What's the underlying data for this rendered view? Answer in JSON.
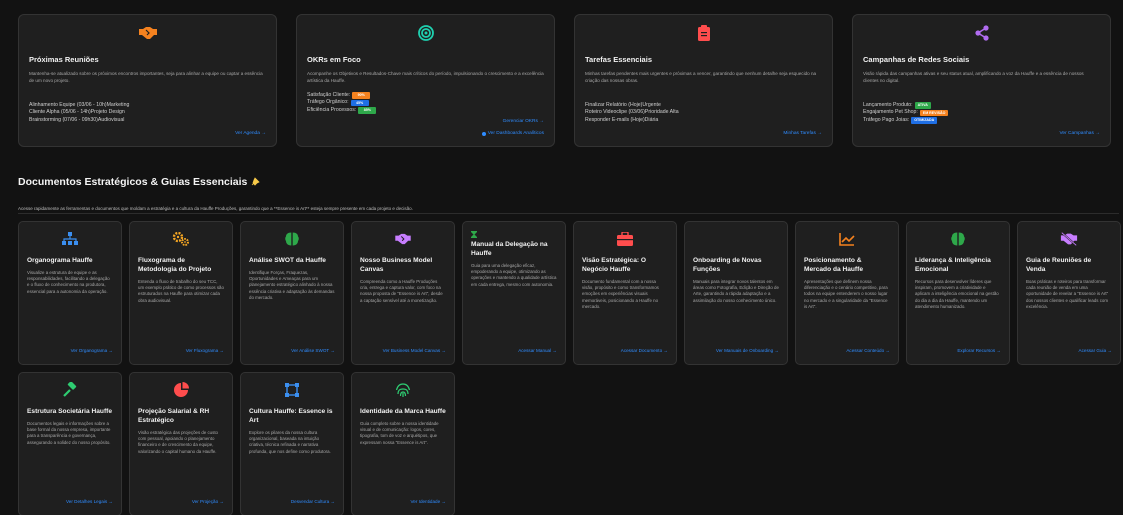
{
  "colors": {
    "accent": "#2f8cff",
    "orange": "#f5821f",
    "green": "#2ea84a",
    "blue": "#1f6fe5",
    "red": "#ff4d4d"
  },
  "top_cards": [
    {
      "icon": "handshake-icon",
      "title": "Próximas Reuniões",
      "desc": "Mantenha-se atualizado sobre os próximos encontros importantes, seja para alinhar a equipe ou captar a essência de um novo projeto.",
      "items": [
        "Alinhamento Equipe (03/06 - 10h)Marketing",
        "Cliente Alpha (05/06 - 14h)Projeto Design",
        "Brainstorming (07/06 - 09h30)Audiovisual"
      ],
      "link": "Ver Agenda →"
    },
    {
      "icon": "target-icon",
      "title": "OKRs em Foco",
      "desc": "Acompanhe os Objetivos e Resultados-Chave mais críticos do período, impulsionando o crescimento e a excelência artística da Hauffe.",
      "items": [
        {
          "label": "Satisfação Cliente:",
          "badge": "90%",
          "color": "#f5821f"
        },
        {
          "label": "Tráfego Orgânico:",
          "badge": "45%",
          "color": "#1f6fe5"
        },
        {
          "label": "Eficiência Processos:",
          "badge": "85%",
          "color": "#2ea84a"
        }
      ],
      "link": "Gerenciar OKRs →",
      "link2": "Ver Dashboards Analíticos"
    },
    {
      "icon": "clipboard-icon",
      "title": "Tarefas Essenciais",
      "desc": "Minhas tarefas pendentes mais urgentes e próximas a vencer, garantindo que nenhum detalhe seja esquecido na criação das nossas obras.",
      "items": [
        "Finalizar Relatório (Hoje)Urgente",
        "Roteiro Videoclipe (03/06)Prioridade Alta",
        "Responder E-mails (Hoje)Diária"
      ],
      "link": "Minhas Tarefas →"
    },
    {
      "icon": "share-icon",
      "title": "Campanhas de Redes Sociais",
      "desc": "Visão rápida das campanhas ativas e seu status atual, amplificando a voz da Hauffe e a essência de nossos clientes no digital.",
      "items": [
        {
          "label": "Lançamento Produto:",
          "badge": "ATIVA",
          "color": "#2ea84a"
        },
        {
          "label": "Engajamento Pet Shop:",
          "badge": "EM REVISÃO",
          "color": "#f5821f"
        },
        {
          "label": "Tráfego Pago Joias:",
          "badge": "OTIMIZADA",
          "color": "#1f6fe5"
        }
      ],
      "link": "Ver Campanhas →"
    }
  ],
  "section": {
    "title": "Documentos Estratégicos & Guias Essenciais",
    "desc": "Acesse rapidamente as ferramentas e documentos que moldam a estratégia e a cultura da Hauffe Produções, garantindo que a **Essence is Art** esteja sempre presente em cada projeto e decisão."
  },
  "docs": [
    {
      "icon": "org-chart-icon",
      "title": "Organograma Hauffe",
      "desc": "Visualize a estrutura de equipe e as responsabilidades, facilitando a delegação e o fluxo de conhecimento na produtora, essencial para a autonomia da operação.",
      "link": "Ver Organograma →"
    },
    {
      "icon": "gears-icon",
      "title": "Fluxograma de Metodologia do Projeto",
      "desc": "Entenda o fluxo de trabalho do seu TCC, um exemplo prático de como processos são estruturados na Hauffe para otimizar cada obra audiovisual.",
      "link": "Ver Fluxograma →"
    },
    {
      "icon": "brain-icon",
      "title": "Análise SWOT da Hauffe",
      "desc": "Identifique Forças, Fraquezas, Oportunidades e Ameaças para um planejamento estratégico alinhado à nossa essência criativa e adaptação às demandas do mercado.",
      "link": "Ver Análise SWOT →"
    },
    {
      "icon": "handshake-icon",
      "title": "Nosso Business Model Canvas",
      "desc": "Compreenda como a Hauffe Produções cria, entrega e captura valor, com foco na nossa proposta de \"Essence is Art\", desde a captação sensível até a monetização.",
      "link": "Ver Business Model Canvas →"
    },
    {
      "icon": "hourglass-icon",
      "title": "Manual da Delegação na Hauffe",
      "desc": "Guia para uma delegação eficaz, empoderando a equipe, otimizando as operações e mantendo a qualidade artística em cada entrega, mesmo com autonomia.",
      "link": "Acessar Manual →"
    },
    {
      "icon": "briefcase-icon",
      "title": "Visão Estratégica: O Negócio Hauffe",
      "desc": "Documento fundamental com a nossa visão, propósito e como transformamos emoções em experiências visuais memoráveis, posicionando a Hauffe no mercado.",
      "link": "Acessar Documento →"
    },
    {
      "icon": "blank-icon",
      "title": "Onboarding de Novas Funções",
      "desc": "Manuais para integrar novos talentos em áreas como Fotografia, Edição e Direção de Arte, garantindo a rápida adaptação e a assimilação do nosso conhecimento único.",
      "link": "Ver Manuais de Onboarding →"
    },
    {
      "icon": "trend-chart-icon",
      "title": "Posicionamento & Mercado da Hauffe",
      "desc": "Apresentações que definem nossa diferenciação e o cenário competitivo, para todos na equipe entenderem o nosso lugar no mercado e a singularidade da \"Essence is Art\".",
      "link": "Acessar Conteúdo →"
    },
    {
      "icon": "brain-icon",
      "title": "Liderança & Inteligência Emocional",
      "desc": "Recursos para desenvolver líderes que inspiram, promovem a criatividade e aplicam a inteligência emocional na gestão do dia a dia da Hauffe, mantendo um atendimento humanizado.",
      "link": "Explorar Recursos →"
    },
    {
      "icon": "handshake-slash-icon",
      "title": "Guia de Reuniões de Venda",
      "desc": "Boas práticas e roteiros para transformar cada reunião de venda em uma oportunidade de revelar a \"Essence is Art\" dos nossos clientes e qualificar leads com excelência.",
      "link": "Acessar Guia →"
    },
    {
      "icon": "gavel-icon",
      "title": "Estrutura Societária Hauffe",
      "desc": "Documentos legais e informações sobre a base formal da nossa empresa, importante para a transparência e governança, assegurando a solidez do nosso propósito.",
      "link": "Ver Detalhes Legais →"
    },
    {
      "icon": "pie-chart-icon",
      "title": "Projeção Salarial & RH Estratégico",
      "desc": "Visão estratégica das projeções de custo com pessoal, apoiando o planejamento financeiro e de crescimento da equipe, valorizando o capital humano da Hauffe.",
      "link": "Ver Projeção →"
    },
    {
      "icon": "vector-square-icon",
      "title": "Cultura Hauffe: Essence is Art",
      "desc": "Explore os pilares da nossa cultura organizacional, baseada na intuição criativa, técnica refinada e narrativa profunda, que nos define como produtora.",
      "link": "Desvendar Cultura →"
    },
    {
      "icon": "fingerprint-icon",
      "title": "Identidade da Marca Hauffe",
      "desc": "Guia completo sobre a nossa identidade visual e de comunicação: logos, cores, tipografia, tom de voz e arquétipos, que expressam nossa \"Essence is Art\".",
      "link": "Ver Identidade →"
    }
  ]
}
